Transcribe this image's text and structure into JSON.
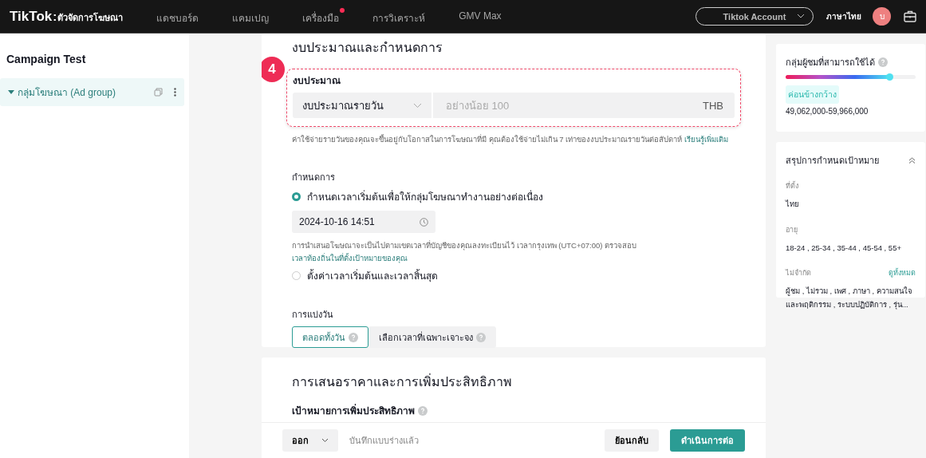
{
  "topbar": {
    "logo": {
      "brand": "TikTok",
      "separator": ":",
      "product": "ตัวจัดการโฆษณา"
    },
    "nav": [
      {
        "label": "แดชบอร์ด",
        "dot": false
      },
      {
        "label": "แคมเปญ",
        "dot": false
      },
      {
        "label": "เครื่องมือ",
        "dot": true
      },
      {
        "label": "การวิเคราะห์",
        "dot": false
      },
      {
        "label": "GMV Max",
        "dot": false
      }
    ],
    "account": "Tiktok Account",
    "language": "ภาษาไทย",
    "avatar": "บ"
  },
  "sidebar": {
    "title": "Campaign Test",
    "items": [
      {
        "label": "กลุ่มโฆษณา (Ad group)",
        "selected": true,
        "expanded": true
      }
    ]
  },
  "budget_section": {
    "title": "งบประมาณและกำหนดการ",
    "step": "4",
    "budget": {
      "label": "งบประมาณ",
      "type": "งบประมาณรายวัน",
      "placeholder": "อย่างน้อย 100",
      "currency": "THB"
    },
    "budget_note": "ค่าใช้จ่ายรายวันของคุณจะขึ้นอยู่กับโอกาสในการโฆษณาที่มี คุณต้องใช้จ่ายไม่เกิน 7 เท่าของงบประมาณรายวันต่อสัปดาห์",
    "budget_link": "เรียนรู้เพิ่มเติม",
    "schedule": {
      "label": "กำหนดการ",
      "options": [
        {
          "label": "กำหนดเวลาเริ่มต้นเพื่อให้กลุ่มโฆษณาทำงานอย่างต่อเนื่อง",
          "selected": true
        },
        {
          "label": "ตั้งค่าเวลาเริ่มต้นและเวลาสิ้นสุด",
          "selected": false
        }
      ],
      "start": "2024-10-16 14:51",
      "note": "การนำเสนอโฆษณาจะเป็นไปตามเขตเวลาที่บัญชีของคุณลงทะเบียนไว้ เวลากรุงเทพ (UTC+07:00) ตรวจสอบ",
      "note_link": "เวลาท้องถิ่นในที่ตั้งเป้าหมายของคุณ"
    },
    "dayparting": {
      "label": "การแบ่งวัน",
      "options": [
        {
          "label": "ตลอดทั้งวัน",
          "selected": true
        },
        {
          "label": "เลือกเวลาที่เฉพาะเจาะจง",
          "selected": false
        }
      ]
    }
  },
  "bidding_section": {
    "title": "การเสนอราคาและการเพิ่มประสิทธิภาพ",
    "goal_label": "เป้าหมายการเพิ่มประสิทธิภาพ"
  },
  "footer": {
    "exit": "ออก",
    "status": "บันทึกแบบร่างแล้ว",
    "back": "ย้อนกลับ",
    "next": "ดำเนินการต่อ"
  },
  "audience": {
    "title": "กลุ่มผู้ชมที่สามารถใช้ได้",
    "level": 0.8,
    "tag": "ค่อนข้างกว้าง",
    "range": "49,062,000-59,966,000"
  },
  "summary": {
    "title": "สรุปการกำหนดเป้าหมาย",
    "expanded": true,
    "groups": [
      {
        "label": "ที่ตั้ง",
        "value": "ไทย"
      },
      {
        "label": "อายุ",
        "value": "18-24 , 25-34 , 35-44 , 45-54 , 55+"
      },
      {
        "label": "ไม่จำกัด",
        "link": "ดูทั้งหมด",
        "value": "ผู้ชม , ไม่รวม , เพศ , ภาษา , ความสนใจและพฤติกรรม , ระบบปฏิบัติการ , รุ่น..."
      }
    ]
  }
}
